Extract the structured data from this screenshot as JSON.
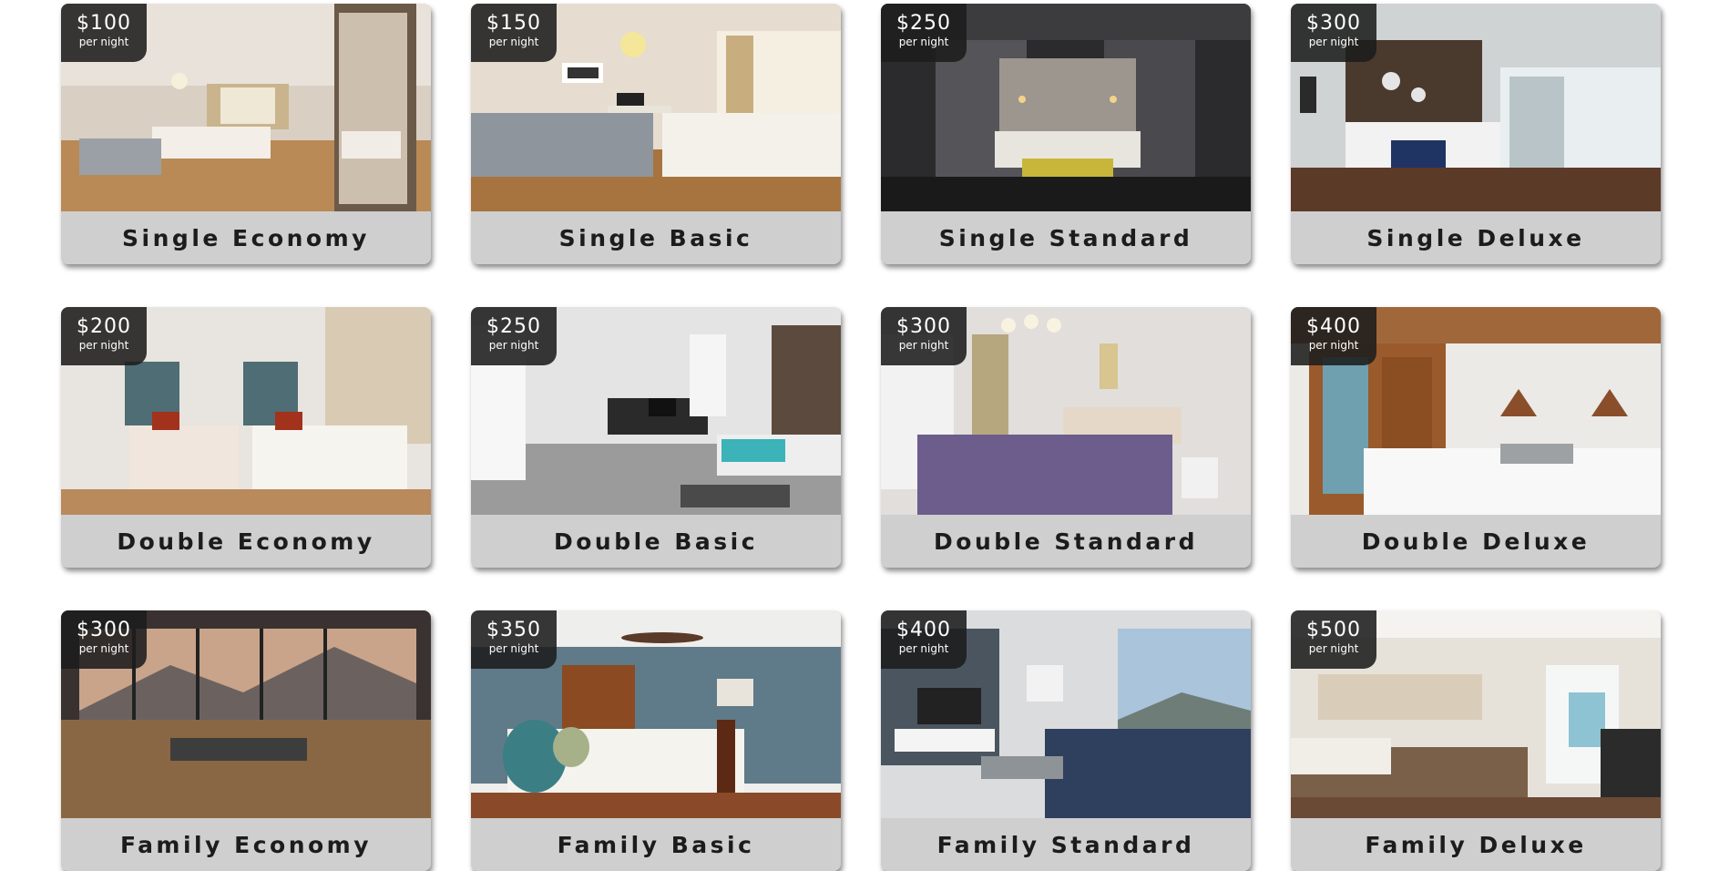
{
  "rooms": [
    {
      "name": "Single Economy",
      "price": "$100",
      "unit": "per night"
    },
    {
      "name": "Single Basic",
      "price": "$150",
      "unit": "per night"
    },
    {
      "name": "Single Standard",
      "price": "$250",
      "unit": "per night"
    },
    {
      "name": "Single Deluxe",
      "price": "$300",
      "unit": "per night"
    },
    {
      "name": "Double Economy",
      "price": "$200",
      "unit": "per night"
    },
    {
      "name": "Double Basic",
      "price": "$250",
      "unit": "per night"
    },
    {
      "name": "Double Standard",
      "price": "$300",
      "unit": "per night"
    },
    {
      "name": "Double Deluxe",
      "price": "$400",
      "unit": "per night"
    },
    {
      "name": "Family Economy",
      "price": "$300",
      "unit": "per night"
    },
    {
      "name": "Family Basic",
      "price": "$350",
      "unit": "per night"
    },
    {
      "name": "Family Standard",
      "price": "$400",
      "unit": "per night"
    },
    {
      "name": "Family Deluxe",
      "price": "$500",
      "unit": "per night"
    }
  ],
  "colors": {
    "badge_bg": "#1c1c1c",
    "label_bg": "#cfcfcf",
    "label_text": "#1c1c1c"
  }
}
